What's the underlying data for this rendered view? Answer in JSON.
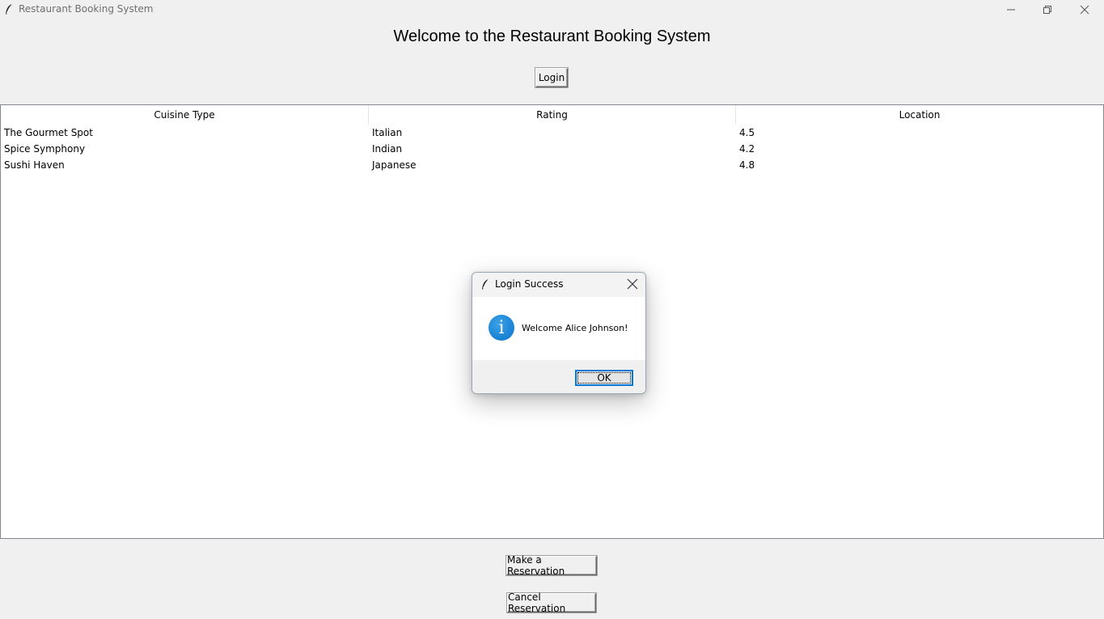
{
  "window": {
    "title": "Restaurant Booking System",
    "icon": "tk-feather-icon",
    "controls": [
      "minimize-icon",
      "restore-icon",
      "close-icon"
    ]
  },
  "main": {
    "heading": "Welcome to the Restaurant Booking System",
    "login_label": "Login"
  },
  "table": {
    "columns": [
      "Cuisine Type",
      "Rating",
      "Location"
    ],
    "rows": [
      [
        "The Gourmet Spot",
        "Italian",
        "4.5"
      ],
      [
        "Spice Symphony",
        "Indian",
        "4.2"
      ],
      [
        "Sushi Haven",
        "Japanese",
        "4.8"
      ]
    ]
  },
  "actions": {
    "reserve_label": "Make a Reservation",
    "cancel_label": "Cancel Reservation"
  },
  "dialog": {
    "title": "Login Success",
    "icon": "info-icon",
    "icon_glyph": "i",
    "message": "Welcome Alice Johnson!",
    "ok_label": "OK",
    "accent": "#0078d7"
  }
}
